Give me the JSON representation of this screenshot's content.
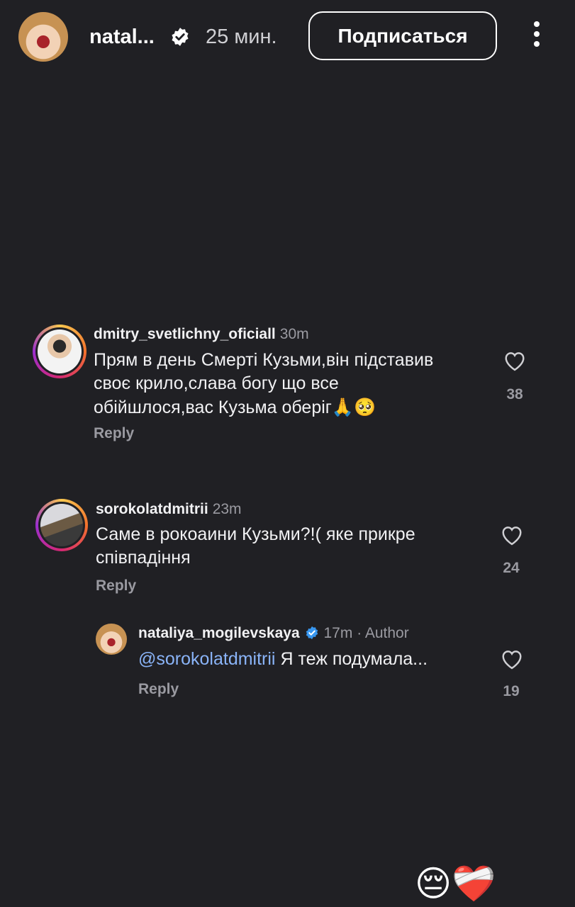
{
  "header": {
    "username": "natal...",
    "time": "25 мин.",
    "follow_label": "Подписаться"
  },
  "comments": [
    {
      "username": "dmitry_svetlichny_oficiall",
      "time": "30m",
      "text_line1": "Прям в день Смерті Кузьми,він підставив",
      "text_line2": "своє крило,слава богу що все",
      "text_line3": "обійшлося,вас Кузьма оберіг",
      "text_emojis": "🙏🥺",
      "reply": "Reply",
      "likes": "38"
    },
    {
      "username": "sorokolatdmitrii",
      "time": "23m",
      "text_line1": "Саме в рокоаини Кузьми?!( яке прикре",
      "text_line2": "співпадіння",
      "reply": "Reply",
      "likes": "24"
    },
    {
      "username": "nataliya_mogilevskaya",
      "time": "17m",
      "author_label": "· Author",
      "mention": "@sorokolatdmitrii",
      "text": "Я теж подумала...",
      "reply": "Reply",
      "likes": "19"
    }
  ],
  "reactions": "😔❤️‍🩹",
  "colors": {
    "background": "#202024",
    "mention": "#8ab4f8",
    "verified": "#3897f0"
  }
}
